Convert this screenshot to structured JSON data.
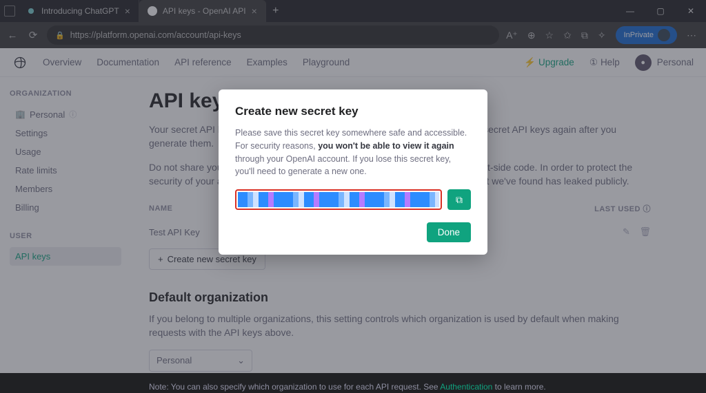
{
  "browser": {
    "tabs": [
      {
        "title": "Introducing ChatGPT"
      },
      {
        "title": "API keys - OpenAI API"
      }
    ],
    "url": "https://platform.openai.com/account/api-keys",
    "inprivate": "InPrivate",
    "win": {
      "min": "—",
      "max": "▢",
      "close": "✕"
    }
  },
  "topnav": {
    "items": [
      "Overview",
      "Documentation",
      "API reference",
      "Examples",
      "Playground"
    ],
    "upgrade": "Upgrade",
    "help": "Help",
    "profile": "Personal"
  },
  "sidebar": {
    "org_header": "ORGANIZATION",
    "org_name": "Personal",
    "items": [
      "Settings",
      "Usage",
      "Rate limits",
      "Members",
      "Billing"
    ],
    "user_header": "USER",
    "user_items": [
      "API keys"
    ]
  },
  "main": {
    "title": "API keys",
    "p1": "Your secret API keys are listed below. Please note that we do not display your secret API keys again after you generate them.",
    "p2": "Do not share your API key with others, or expose it in the browser or other client-side code. In order to protect the security of your account, OpenAI may also automatically rotate any API key that we've found has leaked publicly.",
    "table": {
      "headers": [
        "NAME",
        "",
        "",
        "LAST USED"
      ],
      "row": {
        "name": "Test API Key"
      }
    },
    "create_label": "Create new secret key",
    "h2": "Default organization",
    "p3": "If you belong to multiple organizations, this setting controls which organization is used by default when making requests with the API keys above.",
    "select_value": "Personal",
    "note_pre": "Note: You can also specify which organization to use for each API request. See ",
    "note_link": "Authentication",
    "note_post": " to learn more."
  },
  "modal": {
    "title": "Create new secret key",
    "body_pre": "Please save this secret key somewhere safe and accessible. For security reasons, ",
    "body_bold": "you won't be able to view it again",
    "body_post": " through your OpenAI account. If you lose this secret key, you'll need to generate a new one.",
    "done": "Done"
  }
}
